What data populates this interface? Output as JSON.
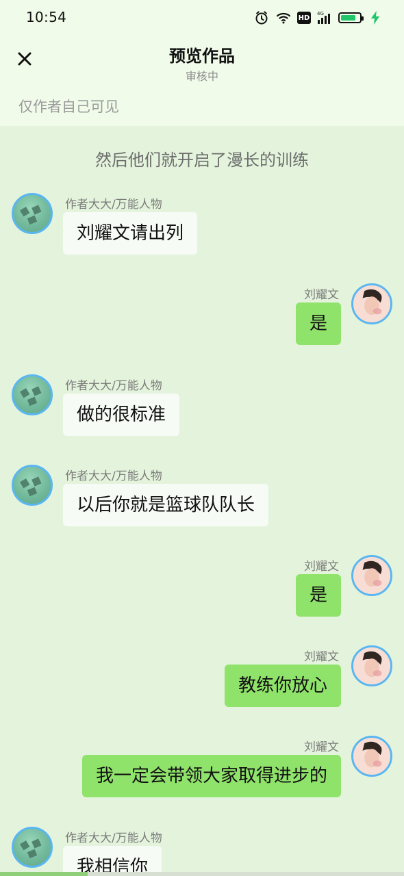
{
  "status_bar": {
    "time": "10:54",
    "icons": [
      "alarm-icon",
      "wifi-icon",
      "hd-icon",
      "signal-icon",
      "battery-icon"
    ],
    "hd_label": "HD",
    "signal_label": "4G",
    "battery_level": 0.82
  },
  "header": {
    "title": "预览作品",
    "subtitle": "审核中",
    "close_icon": "close-icon"
  },
  "visibility_text": "仅作者自己可见",
  "chat": {
    "narration": "然后他们就开启了漫长的训练",
    "messages": [
      {
        "side": "left",
        "name": "作者大大/万能人物",
        "text": "刘耀文请出列"
      },
      {
        "side": "right",
        "name": "刘耀文",
        "text": "是"
      },
      {
        "side": "left",
        "name": "作者大大/万能人物",
        "text": "做的很标准"
      },
      {
        "side": "left",
        "name": "作者大大/万能人物",
        "text": "以后你就是篮球队队长"
      },
      {
        "side": "right",
        "name": "刘耀文",
        "text": "是"
      },
      {
        "side": "right",
        "name": "刘耀文",
        "text": "教练你放心"
      },
      {
        "side": "right",
        "name": "刘耀文",
        "text": "我一定会带领大家取得进步的"
      },
      {
        "side": "left",
        "name": "作者大大/万能人物",
        "text": "我相信你"
      }
    ]
  },
  "colors": {
    "page_background": "#e4f4dc",
    "top_background": "#f0fbea",
    "left_bubble": "#f7fbf6",
    "right_bubble": "#8fe26a",
    "avatar_border": "#59b6f2",
    "battery_fill": "#21c56b"
  }
}
